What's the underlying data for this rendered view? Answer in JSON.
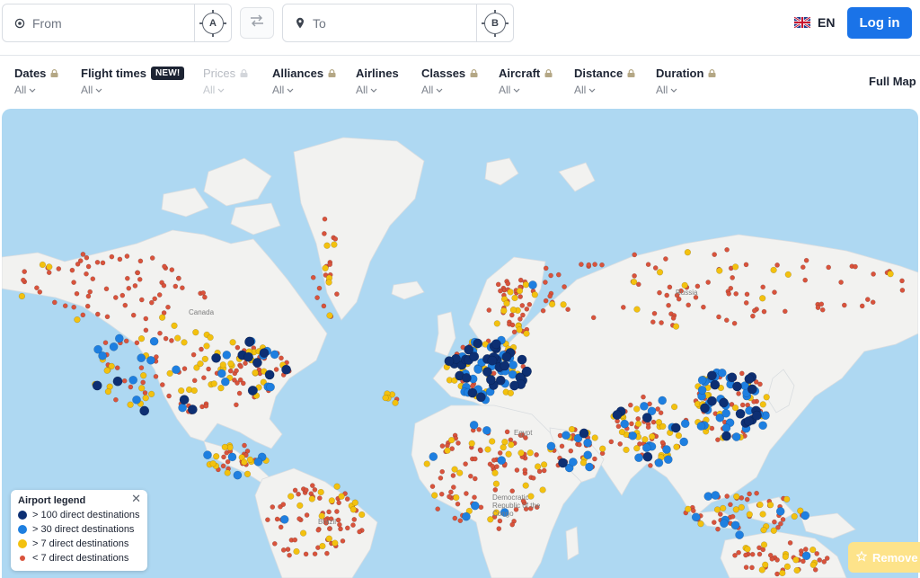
{
  "search": {
    "from_placeholder": "From",
    "to_placeholder": "To",
    "from_badge": "A",
    "to_badge": "B"
  },
  "header": {
    "language": "EN",
    "login_label": "Log in"
  },
  "filters": [
    {
      "label": "Dates",
      "value": "All",
      "locked": true,
      "badge": "",
      "disabled": false
    },
    {
      "label": "Flight times",
      "value": "All",
      "locked": false,
      "badge": "NEW!",
      "disabled": false
    },
    {
      "label": "Prices",
      "value": "All",
      "locked": true,
      "badge": "",
      "disabled": true
    },
    {
      "label": "Alliances",
      "value": "All",
      "locked": true,
      "badge": "",
      "disabled": false
    },
    {
      "label": "Airlines",
      "value": "All",
      "locked": false,
      "badge": "",
      "disabled": false
    },
    {
      "label": "Classes",
      "value": "All",
      "locked": true,
      "badge": "",
      "disabled": false
    },
    {
      "label": "Aircraft",
      "value": "All",
      "locked": true,
      "badge": "",
      "disabled": false
    },
    {
      "label": "Distance",
      "value": "All",
      "locked": true,
      "badge": "",
      "disabled": false
    },
    {
      "label": "Duration",
      "value": "All",
      "locked": true,
      "badge": "",
      "disabled": false
    }
  ],
  "full_map_label": "Full Map",
  "map": {
    "labels": {
      "canada": "Canada",
      "russia": "Russia",
      "egypt": "Egypt",
      "drc": "Democratic Republic of the Congo",
      "brazil": "Brazil"
    },
    "colors": {
      "ocean": "#aed8f2",
      "land": "#f2f2f0",
      "dark_blue": "#0d2f73",
      "blue": "#1e7fe0",
      "yellow": "#f3c10f",
      "red": "#d9533c"
    }
  },
  "legend": {
    "title": "Airport legend",
    "items": [
      {
        "label": "> 100 direct destinations",
        "color": "#0d2f73"
      },
      {
        "label": "> 30 direct destinations",
        "color": "#1e7fe0"
      },
      {
        "label": "> 7 direct destinations",
        "color": "#f3c10f"
      },
      {
        "label": "< 7 direct destinations",
        "color": "#d9533c"
      }
    ]
  },
  "remove_label": "Remove"
}
